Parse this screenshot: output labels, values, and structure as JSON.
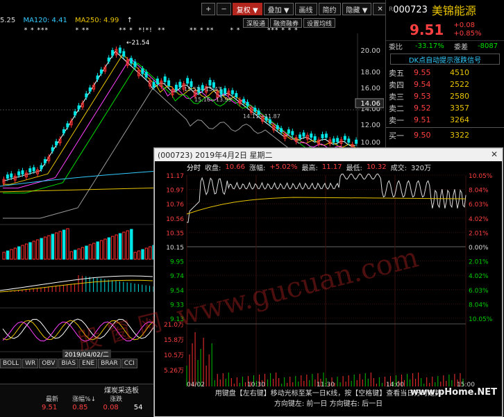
{
  "ma_legend": {
    "ma_first": "5.25",
    "ma120": "MA120: 4.41",
    "ma250": "MA250: 4.99",
    "arrow": "↑"
  },
  "toolbar": {
    "plus": "+",
    "minus": "−",
    "restore": "复权 ▼",
    "overlay": "叠加 ▼",
    "draw": "画线",
    "simple": "简约",
    "hide": "隐藏 ▼",
    "close_x": "✕"
  },
  "sub_toolbar": {
    "a": "深股通",
    "b": "融资融券",
    "c": "设置均线"
  },
  "price_axis": [
    "20.00",
    "18.00",
    "16.00",
    "14.00",
    "12.00",
    "10.00"
  ],
  "price_highlight": "14.06",
  "peak_label": "21.54",
  "seg_labels": [
    "15.52—15.43",
    "15.16—13.99",
    "14.11—11.87"
  ],
  "date_marker": "2019/04/02/二",
  "tabs": [
    "BOLL",
    "WR",
    "OBV",
    "BIAS",
    "ENE",
    "BRAR",
    "CCI"
  ],
  "bottom_panel": {
    "title": "煤炭采选板",
    "headers": [
      "最新",
      "涨幅%↓",
      "涨跌"
    ],
    "values": [
      "9.51",
      "0.85",
      "0.08",
      "54"
    ]
  },
  "quote": {
    "code": "000723",
    "name": "美锦能源",
    "price": "9.51",
    "change": "+0.08",
    "change_pct": "+0.85%",
    "wb_label": "委比",
    "wb_value": "-33.17%",
    "wc_label": "委差",
    "wc_value": "-8087",
    "signal_btn": "DK点自动提示涨跌信号",
    "asks": [
      {
        "label": "卖五",
        "price": "9.55",
        "vol": "4510"
      },
      {
        "label": "卖四",
        "price": "9.54",
        "vol": "2522"
      },
      {
        "label": "卖三",
        "price": "9.53",
        "vol": "2580"
      },
      {
        "label": "卖二",
        "price": "9.52",
        "vol": "3357"
      },
      {
        "label": "卖一",
        "price": "9.51",
        "vol": "3264"
      }
    ],
    "bids": [
      {
        "label": "买一",
        "price": "9.50",
        "vol": "3322"
      }
    ]
  },
  "popup": {
    "title": "(000723) 2019年4月2日 星期二",
    "close": "✕",
    "info": {
      "tab": "分时",
      "close_l": "收盘:",
      "close_v": "10.66",
      "amp_l": "涨幅:",
      "amp_v": "+5.02%",
      "high_l": "最高:",
      "high_v": "11.17",
      "low_l": "最低:",
      "low_v": "10.32",
      "vol_l": "成交:",
      "vol_v": "320万"
    },
    "left_axis": [
      "11.17",
      "10.97",
      "10.76",
      "10.56",
      "10.35",
      "10.15",
      "9.95",
      "9.74",
      "9.54",
      "9.33",
      "9.13"
    ],
    "right_axis": [
      "10.05%",
      "8.04%",
      "6.03%",
      "4.02%",
      "2.01%",
      "0.00%",
      "2.01%",
      "4.02%",
      "6.03%",
      "8.04%",
      "10.05%"
    ],
    "vol_axis": [
      "21.0万",
      "15.8万",
      "10.5万",
      "5.26万"
    ],
    "time_axis": [
      "04/02",
      "10:30",
      "11:30",
      "14:00",
      "15:00"
    ],
    "foot1": "用键盘【左右键】移动光标至某一日K线，按【空格键】查看当日分时走势",
    "foot2": "方向键左: 前一日    方向键右: 后一日"
  },
  "watermark": {
    "site": "www.gucuan.com",
    "cn": "股 窗 网",
    "corner": "www.pHome.NET"
  },
  "colors": {
    "up": "#ff4040",
    "down": "#00e0e0",
    "yellow": "#e8c400",
    "green": "#00c000",
    "bg": "#000000"
  }
}
